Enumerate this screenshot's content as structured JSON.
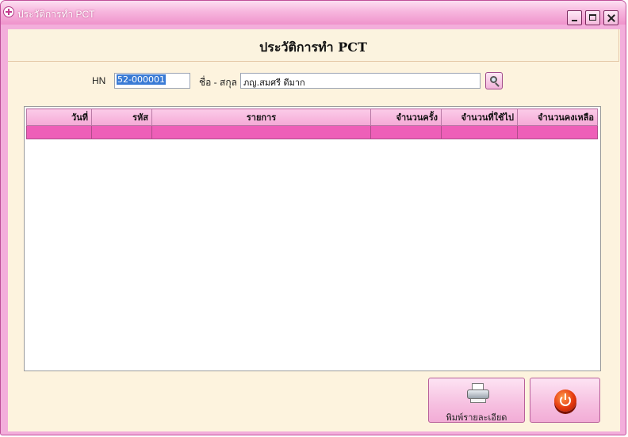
{
  "window": {
    "title": "ประวัติการทำ PCT",
    "icon": "plus-circle-icon",
    "controls": [
      "minimize-icon",
      "maximize-icon",
      "close-icon"
    ]
  },
  "header": {
    "title": "ประวัติการทำ PCT"
  },
  "form": {
    "hn_label": "HN",
    "hn_value": "52-000001",
    "name_label": "ชื่อ - สกุล",
    "name_value": "ภญ.สมศรี ดีมาก",
    "search_icon": "search-icon"
  },
  "table": {
    "columns": [
      "วันที่",
      "รหัส",
      "รายการ",
      "จำนวนครั้ง",
      "จำนวนที่ใช้ไป",
      "จำนวนคงเหลือ"
    ],
    "rows": [
      [
        "",
        "",
        "",
        "",
        "",
        ""
      ]
    ],
    "selected_row_color": "#ee5fb8",
    "header_color": "#f8bde2"
  },
  "buttons": {
    "print_label": "พิมพ์รายละเอียด",
    "print_icon": "printer-icon",
    "exit_icon": "power-icon"
  },
  "colors": {
    "frame": "#f3aedb",
    "client": "#fdf3de"
  }
}
